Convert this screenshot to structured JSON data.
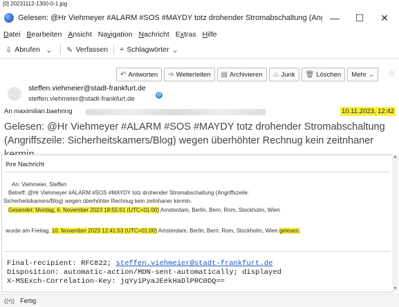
{
  "top_caption": "[0] 20231112-1300-0-1.jpg",
  "window": {
    "title": "Gelesen: @Hr Viehmeyer #ALARM #SOS #MAYDY totz drohender Stromabschaltung (Angriffsze...",
    "minimize": "—",
    "maximize": "☐",
    "close": "✕"
  },
  "menu": [
    {
      "key": "D",
      "rest": "atei"
    },
    {
      "key": "B",
      "rest": "earbeiten"
    },
    {
      "key": "A",
      "rest": "nsicht"
    },
    {
      "pre": "Na",
      "key": "v",
      "rest": "igation"
    },
    {
      "key": "N",
      "rest": "achricht"
    },
    {
      "pre": "E",
      "key": "x",
      "rest": "tras"
    },
    {
      "key": "H",
      "rest": "ilfe"
    }
  ],
  "toolbar": {
    "fetch": "Abrufen",
    "compose": "Verfassen",
    "tags": "Schlagwörter"
  },
  "actions": {
    "reply": "Antworten",
    "forward": "Weiterleiten",
    "archive": "Archivieren",
    "junk": "Junk",
    "delete": "Löschen",
    "more": "Mehr"
  },
  "header": {
    "from_line1": "steffen.viehmeier@stadt-frankfurt.de",
    "from_line2": "steffen.viehmeier@stadt-frankfurt.de",
    "to_label": "An",
    "to_name": "maximilian.baehring",
    "date": "10.11.2023, 12:42",
    "subject": "Gelesen: @Hr Viehmeyer #ALARM #SOS #MAYDY totz drohender Stromabschaltung (Angriffszeile: Sicherheitskamers/Blog) wegen überhöhter Rechnug kein zeitnhaner kermin"
  },
  "body": {
    "ihre": "Ihre Nachricht",
    "an": "An: Viehmeier, Steffen",
    "betreff1": "Betreff: @Hr Viehmeyer #ALARM #SOS #MAYDY totz drohender Stromabschaltung (Angriffszeile:",
    "betreff2": "Sicherheitskamers/Blog) wegen überhöhter Rechnug kein zeitnhaner kermin.",
    "gesendet": "Gesendet: Montag, 6. November 2023 18:55:51 (UTC+01:00)",
    "gesendet_rest": " Amsterdam, Berlin, Bern, Rom, Stockholm, Wien",
    "wurde": "wurde am Freitag, ",
    "wurde_date": "10. November 2023 12:41:53 (UTC+01:00)",
    "wurde_rest": " Amsterdam, Berlin, Bern, Rom, Stockholm, Wien ",
    "gelesen": "gelesen.",
    "final_label": "Final-recipient: RFC822; ",
    "final_link": "steffen.viehmeier@stadt-frankfurt.de",
    "disposition": "Disposition: automatic-action/MDN-sent-automatically; displayed",
    "correlation": "X-MSExch-Correlation-Key: jqYyiPyaJEekHaDlPRC0DQ=="
  },
  "status": {
    "text": "Fertig"
  },
  "colors": {
    "highlight": "#f7ee3c",
    "link": "#1a56c9"
  }
}
